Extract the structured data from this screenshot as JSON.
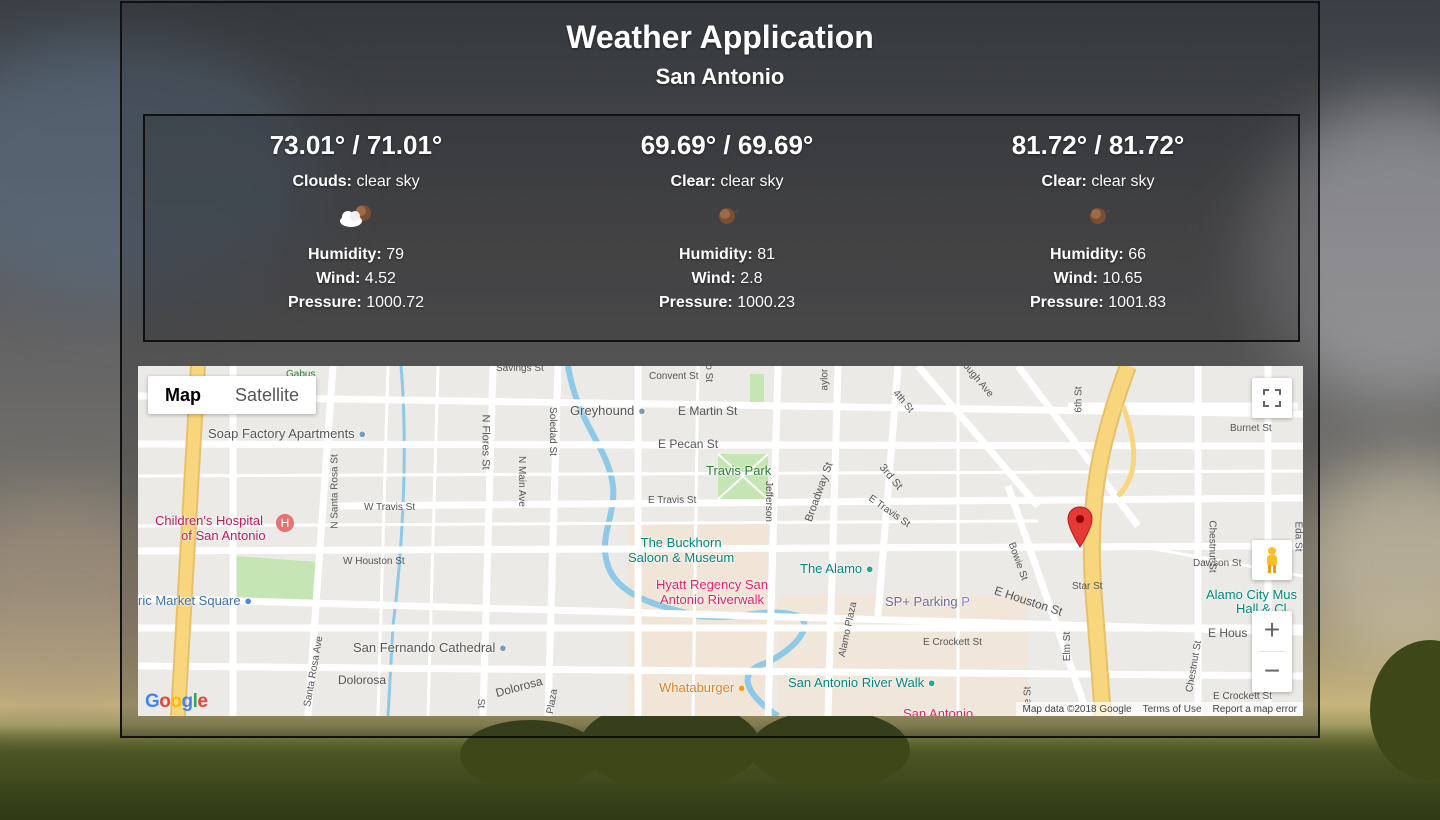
{
  "app": {
    "title": "Weather Application",
    "city": "San Antonio"
  },
  "forecast": [
    {
      "temp": "73.01° / 71.01°",
      "main": "Clouds:",
      "desc": "clear sky",
      "icon": "clouds-icon",
      "humidity_label": "Humidity:",
      "humidity": "79",
      "wind_label": "Wind:",
      "wind": "4.52",
      "pressure_label": "Pressure:",
      "pressure": "1000.72"
    },
    {
      "temp": "69.69° / 69.69°",
      "main": "Clear:",
      "desc": "clear sky",
      "icon": "clear-icon",
      "humidity_label": "Humidity:",
      "humidity": "81",
      "wind_label": "Wind:",
      "wind": "2.8",
      "pressure_label": "Pressure:",
      "pressure": "1000.23"
    },
    {
      "temp": "81.72° / 81.72°",
      "main": "Clear:",
      "desc": "clear sky",
      "icon": "clear-icon",
      "humidity_label": "Humidity:",
      "humidity": "66",
      "wind_label": "Wind:",
      "wind": "10.65",
      "pressure_label": "Pressure:",
      "pressure": "1001.83"
    }
  ],
  "map": {
    "map_type_map": "Map",
    "map_type_satellite": "Satellite",
    "zoom_in": "+",
    "zoom_out": "−",
    "logo": "Google",
    "attribution": {
      "data": "Map data ©2018 Google",
      "terms": "Terms of Use",
      "report": "Report a map error"
    },
    "pois": {
      "greyhound": "Greyhound",
      "soap_factory": "Soap Factory Apartments",
      "travis_park": "Travis Park",
      "childrens_hospital_1": "Children's Hospital",
      "childrens_hospital_2": "of San Antonio",
      "buckhorn_1": "The Buckhorn",
      "buckhorn_2": "Saloon & Museum",
      "hyatt_1": "Hyatt Regency San",
      "hyatt_2": "Antonio Riverwalk",
      "alamo": "The Alamo",
      "sp_parking": "SP+ Parking",
      "market_square": "ric Market Square",
      "cathedral": "San Fernando Cathedral",
      "whataburger": "Whataburger",
      "river_walk": "San Antonio River Walk",
      "alamo_city_1": "Alamo City Mus",
      "alamo_city_2": "Hall & Cl",
      "san_antonio_bottom": "San Antonio"
    },
    "streets": {
      "e_martin": "E Martin St",
      "e_pecan": "E Pecan St",
      "e_travis": "E Travis St",
      "w_travis": "W Travis St",
      "w_houston": "W Houston St",
      "e_houston": "E Houston St",
      "n_flores": "N Flores St",
      "soledad": "Soledad St",
      "n_main": "N Main Ave",
      "n_santa_rosa": "N Santa Rosa St",
      "santa_rosa_ave": "Santa Rosa Ave",
      "broadway": "Broadway St",
      "third": "3rd St",
      "fourth": "4th St",
      "jefferson": "Jefferson",
      "bowie": "Bowie St",
      "alamo_plaza": "Alamo Plaza",
      "dolorosa_w": "Dolorosa",
      "dolorosa_e": "Dolorosa",
      "e_crockett": "E Crockett St",
      "e_crockett_2": "E Crockett St",
      "star": "Star St",
      "elm": "Elm St",
      "dawson": "Dawson St",
      "burnet": "Burnet St",
      "chestnut": "Chestnut St",
      "chestnut_2": "Chestnut St",
      "convent": "Convent St",
      "savings": "Savings St",
      "culloughs": "Cullough Ave",
      "sixth": "6th St",
      "e_hous_2": "E Hous",
      "taylor": "aylor St",
      "ro_st": "ro St",
      "eda": "Eda St",
      "ie_st": "ie St",
      "plaza": "Plaza",
      "st_bottom": "St",
      "gabus": "Gabus"
    }
  },
  "colors": {
    "panel_border": "#111111",
    "freeway": "#f8d67e",
    "water": "#8ec9e8",
    "park": "#c5e6b4",
    "marker": "#e53935"
  }
}
